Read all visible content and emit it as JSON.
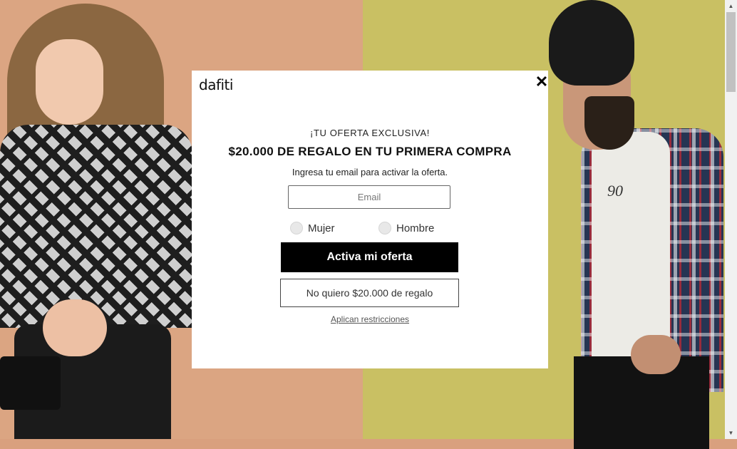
{
  "brand": {
    "logo_text": "dafiti"
  },
  "modal": {
    "close_symbol": "✕",
    "eyebrow": "¡TU OFERTA EXCLUSIVA!",
    "headline": "$20.000 DE REGALO EN TU PRIMERA COMPRA",
    "subtext": "Ingresa tu email para activar la oferta.",
    "email": {
      "value": "",
      "placeholder": "Email"
    },
    "gender_options": [
      {
        "label": "Mujer",
        "selected": false
      },
      {
        "label": "Hombre",
        "selected": false
      }
    ],
    "primary_button": "Activa mi oferta",
    "secondary_button": "No quiero $20.000 de regalo",
    "restrictions_link": "Aplican restricciones"
  },
  "background": {
    "left_color": "#dba582",
    "right_color": "#c9c063",
    "tee_print": "90"
  },
  "scrollbar": {
    "up_arrow": "▲",
    "down_arrow": "▼"
  }
}
